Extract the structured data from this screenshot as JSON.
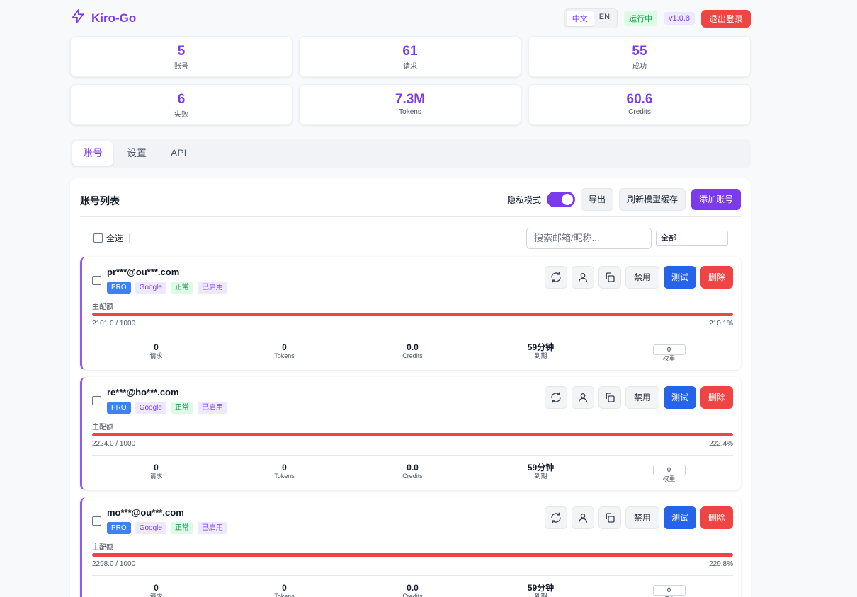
{
  "app": {
    "title": "Kiro-Go"
  },
  "header": {
    "lang_zh": "中文",
    "lang_en": "EN",
    "status": "运行中",
    "version": "v1.0.8",
    "logout": "退出登录"
  },
  "stats": [
    {
      "value": "5",
      "label": "账号"
    },
    {
      "value": "61",
      "label": "请求"
    },
    {
      "value": "55",
      "label": "成功"
    },
    {
      "value": "6",
      "label": "失败"
    },
    {
      "value": "7.3M",
      "label": "Tokens"
    },
    {
      "value": "60.6",
      "label": "Credits"
    }
  ],
  "tabs": [
    {
      "label": "账号",
      "active": true
    },
    {
      "label": "设置",
      "active": false
    },
    {
      "label": "API",
      "active": false
    }
  ],
  "panel": {
    "title": "账号列表",
    "privacy_label": "隐私模式",
    "privacy_on": true,
    "export": "导出",
    "refresh_cache": "刷新模型缓存",
    "add_account": "添加账号",
    "select_all": "全选",
    "search_placeholder": "搜索邮箱/昵称...",
    "filter_value": "全部"
  },
  "accounts": [
    {
      "email": "pr***@ou***.com",
      "tags": [
        "PRO",
        "Google",
        "正常",
        "已启用"
      ],
      "quota_label": "主配额",
      "quota_text": "2101.0 / 1000",
      "quota_pct": "210.1%",
      "requests": "0",
      "requests_label": "请求",
      "tokens": "0",
      "tokens_label": "Tokens",
      "credits": "0.0",
      "credits_label": "Credits",
      "expiry": "59分钟",
      "expiry_label": "到期",
      "weight": "0",
      "weight_label": "权重"
    },
    {
      "email": "re***@ho***.com",
      "tags": [
        "PRO",
        "Google",
        "正常",
        "已启用"
      ],
      "quota_label": "主配额",
      "quota_text": "2224.0 / 1000",
      "quota_pct": "222.4%",
      "requests": "0",
      "requests_label": "请求",
      "tokens": "0",
      "tokens_label": "Tokens",
      "credits": "0.0",
      "credits_label": "Credits",
      "expiry": "59分钟",
      "expiry_label": "到期",
      "weight": "0",
      "weight_label": "权重"
    },
    {
      "email": "mo***@ou***.com",
      "tags": [
        "PRO",
        "Google",
        "正常",
        "已启用"
      ],
      "quota_label": "主配额",
      "quota_text": "2298.0 / 1000",
      "quota_pct": "229.8%",
      "requests": "0",
      "requests_label": "请求",
      "tokens": "0",
      "tokens_label": "Tokens",
      "credits": "0.0",
      "credits_label": "Credits",
      "expiry": "59分钟",
      "expiry_label": "到期",
      "weight": "0",
      "weight_label": "权重"
    }
  ],
  "card_actions": {
    "disable": "禁用",
    "test": "测试",
    "delete": "删除"
  },
  "icons": {
    "logo": "bolt-icon",
    "refresh": "refresh-icon",
    "user": "user-icon",
    "copy": "copy-icon"
  },
  "colors": {
    "accent": "#7c3aed",
    "danger": "#ef4444",
    "primary": "#2563eb",
    "success": "#16a34a"
  }
}
